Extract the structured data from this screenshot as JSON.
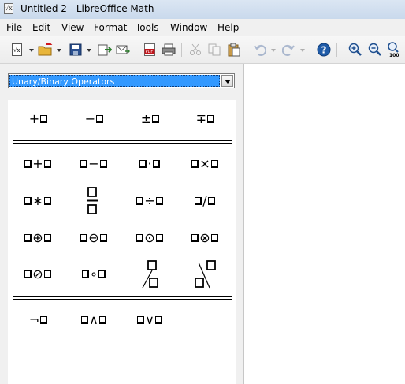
{
  "window": {
    "title": "Untitled 2 - LibreOffice Math",
    "app_icon": "math-document-icon"
  },
  "menu": [
    {
      "accel": "F",
      "rest": "ile"
    },
    {
      "accel": "E",
      "rest": "dit"
    },
    {
      "accel": "V",
      "rest": "iew"
    },
    {
      "pre": "F",
      "accel": "o",
      "rest": "rmat"
    },
    {
      "accel": "T",
      "rest": "ools"
    },
    {
      "accel": "W",
      "rest": "indow"
    },
    {
      "accel": "H",
      "rest": "elp"
    }
  ],
  "toolbar": {
    "icons": [
      "new-icon",
      "open-icon",
      "save-icon",
      "export-icon",
      "email-icon",
      "export-pdf-icon",
      "print-icon",
      "cut-icon",
      "copy-icon",
      "paste-icon",
      "undo-icon",
      "redo-icon",
      "help-icon",
      "zoom-in-icon",
      "zoom-out-icon",
      "zoom-100-icon"
    ],
    "zoom_100_label": "100"
  },
  "panel": {
    "category": "Unary/Binary Operators",
    "unary": [
      "+",
      "−",
      "±",
      "∓"
    ],
    "binary_rows": [
      [
        "+",
        "−",
        "·",
        "×"
      ],
      [
        "∗",
        "frac",
        "÷",
        "/"
      ],
      [
        "⊕",
        "⊖",
        "⊙",
        "⊗"
      ],
      [
        "⊘",
        "∘",
        "wideslash",
        "widebslash"
      ]
    ],
    "logic": [
      "¬",
      "∧",
      "∨"
    ]
  },
  "colors": {
    "selection": "#3399ff",
    "panel_bg": "#f0f0f0"
  }
}
